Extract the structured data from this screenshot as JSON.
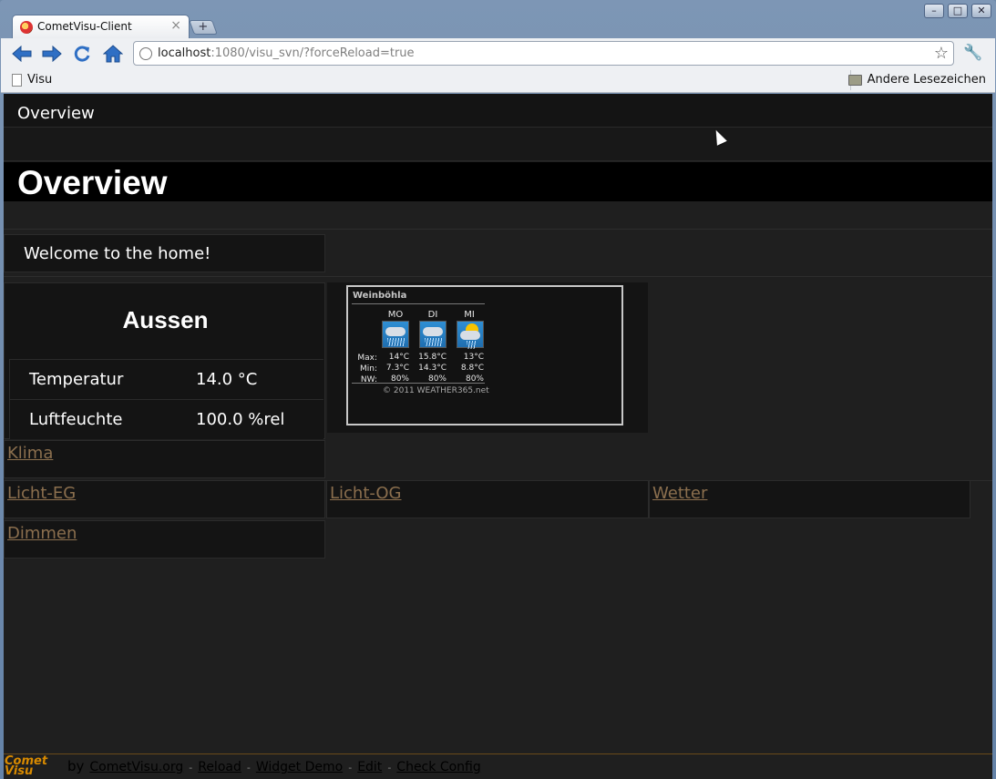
{
  "browser": {
    "tab_title": "CometVisu-Client",
    "tab_close": "×",
    "new_tab": "+",
    "url_host": "localhost",
    "url_rest": ":1080/visu_svn/?forceReload=true",
    "window_buttons": {
      "minimize": "–",
      "maximize": "□",
      "close": "✕"
    }
  },
  "bookmarks": {
    "left": "Visu",
    "right": "Andere Lesezeichen"
  },
  "page": {
    "nav_label": "Overview",
    "title": "Overview",
    "welcome": "Welcome to the home!",
    "aussen": {
      "title": "Aussen",
      "rows": [
        {
          "label": "Temperatur",
          "value": "14.0 °C"
        },
        {
          "label": "Luftfeuchte",
          "value": "100.0 %rel"
        }
      ]
    },
    "weather": {
      "city": "Weinböhla",
      "days": [
        "MO",
        "DI",
        "MI"
      ],
      "row_labels": [
        "Max:",
        "Min:",
        "NW:"
      ],
      "max": [
        "14°C",
        "15.8°C",
        "13°C"
      ],
      "min": [
        "7.3°C",
        "14.3°C",
        "8.8°C"
      ],
      "nw": [
        "80%",
        "80%",
        "80%"
      ],
      "copyright": "© 2011 WEATHER365.net"
    },
    "links": {
      "klima": "Klima",
      "licht_eg": "Licht-EG",
      "licht_og": "Licht-OG",
      "wetter": "Wetter",
      "dimmen": "Dimmen"
    }
  },
  "footer": {
    "logo_top": "Comet",
    "logo_bottom": "Visu",
    "by": "by",
    "links": [
      "CometVisu.org",
      "Reload",
      "Widget Demo",
      "Edit",
      "Check Config"
    ],
    "dash": "-"
  }
}
